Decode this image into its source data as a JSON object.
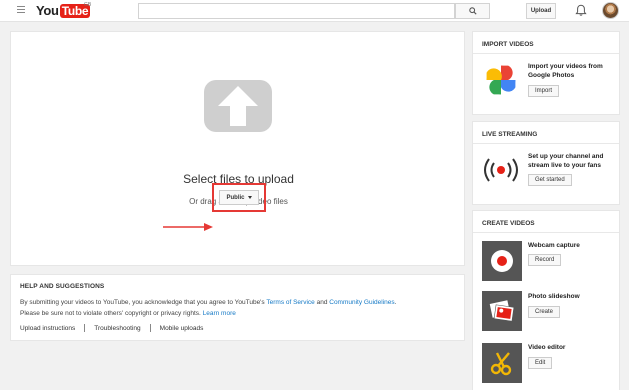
{
  "header": {
    "logo_you": "You",
    "logo_tube": "Tube",
    "country_code": "GB",
    "search_placeholder": "",
    "upload_label": "Upload"
  },
  "upload": {
    "title": "Select files to upload",
    "subtitle": "Or drag and drop video files",
    "privacy_value": "Public",
    "privacy_options": [
      "Public"
    ],
    "highlight_color": "#e53935"
  },
  "help": {
    "title": "HELP AND SUGGESTIONS",
    "line1_a": "By submitting your videos to YouTube, you acknowledge that you agree to YouTube's ",
    "terms_link": "Terms of Service",
    "line1_b": " and ",
    "guidelines_link": "Community Guidelines",
    "line1_c": ".",
    "line2_a": "Please be sure not to violate others' copyright or privacy rights. ",
    "learn_more_link": "Learn more",
    "links": {
      "upload_instructions": "Upload instructions",
      "troubleshooting": "Troubleshooting",
      "mobile_uploads": "Mobile uploads"
    }
  },
  "sidebar": {
    "import": {
      "title": "IMPORT VIDEOS",
      "desc": "Import your videos from Google Photos",
      "button": "Import",
      "icon": "google-photos-icon"
    },
    "live": {
      "title": "LIVE STREAMING",
      "desc": "Set up your channel and stream live to your fans",
      "button": "Get started",
      "icon": "live-broadcast-icon"
    },
    "create": {
      "title": "CREATE VIDEOS",
      "items": [
        {
          "label": "Webcam capture",
          "button": "Record",
          "icon": "record-icon"
        },
        {
          "label": "Photo slideshow",
          "button": "Create",
          "icon": "photos-stack-icon"
        },
        {
          "label": "Video editor",
          "button": "Edit",
          "icon": "scissors-icon"
        }
      ]
    }
  },
  "colors": {
    "brand_red": "#e62117",
    "link_blue": "#167ac6",
    "background": "#f1f1f1"
  }
}
